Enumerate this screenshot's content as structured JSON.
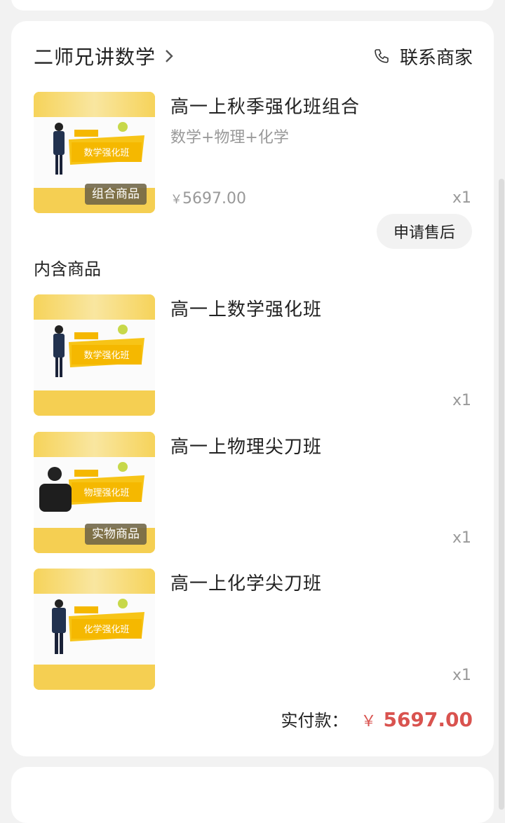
{
  "shop": {
    "name": "二师兄讲数学",
    "contact_label": "联系商家"
  },
  "bundle": {
    "title": "高一上秋季强化班组合",
    "subtitle": "数学+物理+化学",
    "currency": "￥",
    "price": "5697.00",
    "qty": "x1",
    "badge": "组合商品",
    "after_sale_label": "申请售后",
    "thumb_text": "数学强化班"
  },
  "contents_label": "内含商品",
  "items": [
    {
      "title": "高一上数学强化班",
      "qty": "x1",
      "thumb_text": "数学强化班"
    },
    {
      "title": "高一上物理尖刀班",
      "qty": "x1",
      "thumb_text": "物理强化班",
      "badge": "实物商品"
    },
    {
      "title": "高一上化学尖刀班",
      "qty": "x1",
      "thumb_text": "化学强化班"
    }
  ],
  "total": {
    "label": "实付款：",
    "currency": "￥",
    "amount": "5697.00"
  },
  "colors": {
    "accent_red": "#d9534f",
    "thumb_yellow": "#f5cf52"
  }
}
